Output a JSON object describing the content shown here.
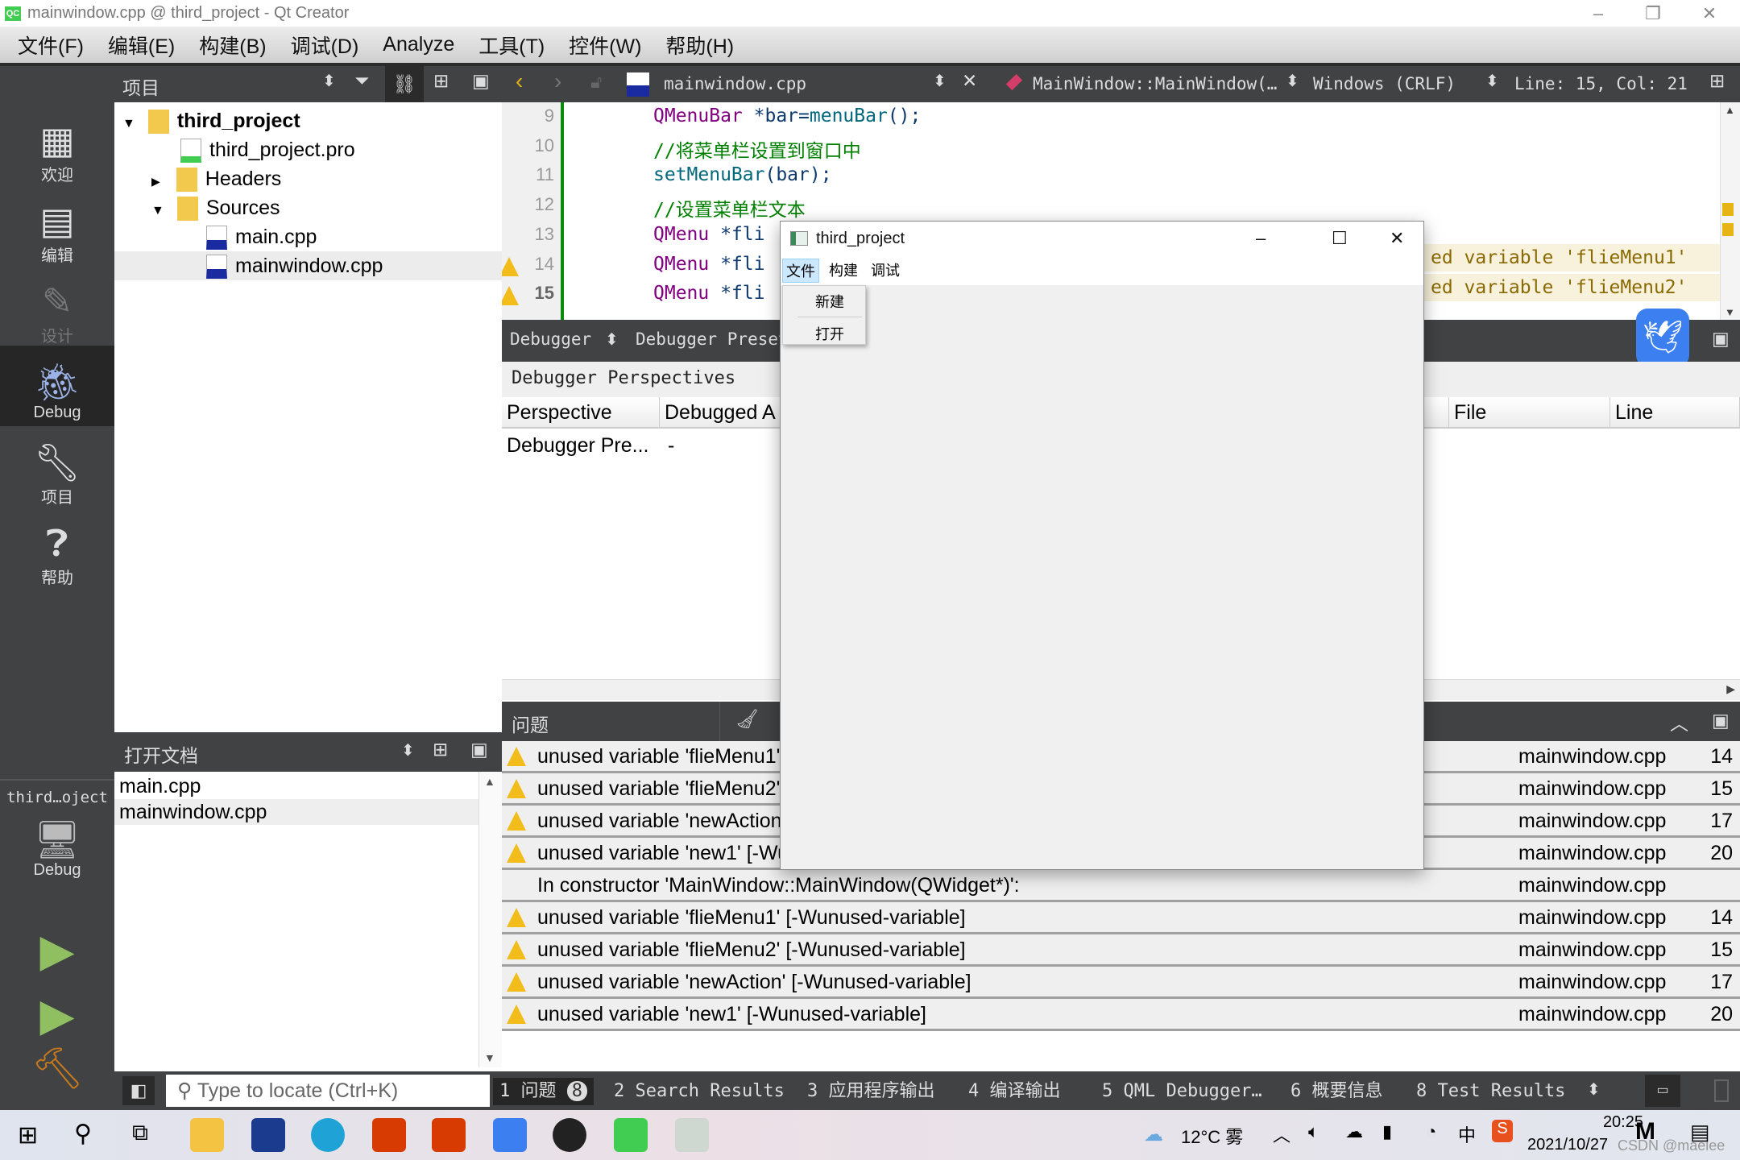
{
  "window": {
    "title": "mainwindow.cpp @ third_project - Qt Creator"
  },
  "menubar": [
    "文件(F)",
    "编辑(E)",
    "构建(B)",
    "调试(D)",
    "Analyze",
    "工具(T)",
    "控件(W)",
    "帮助(H)"
  ],
  "modes": [
    {
      "label": "欢迎",
      "icon": "grid-icon"
    },
    {
      "label": "编辑",
      "icon": "document-icon"
    },
    {
      "label": "设计",
      "icon": "pencil-icon"
    },
    {
      "label": "Debug",
      "icon": "bug-icon",
      "active": true
    },
    {
      "label": "项目",
      "icon": "wrench-icon"
    },
    {
      "label": "帮助",
      "icon": "help-icon"
    }
  ],
  "kit": {
    "project": "third…oject",
    "config": "Debug"
  },
  "project_panel": {
    "title": "项目",
    "tree": [
      {
        "label": "third_project",
        "level": 0,
        "expanded": true
      },
      {
        "label": "third_project.pro",
        "level": 1
      },
      {
        "label": "Headers",
        "level": 1,
        "expanded": false
      },
      {
        "label": "Sources",
        "level": 1,
        "expanded": true
      },
      {
        "label": "main.cpp",
        "level": 2
      },
      {
        "label": "mainwindow.cpp",
        "level": 2,
        "selected": true
      }
    ]
  },
  "open_docs": {
    "title": "打开文档",
    "items": [
      "main.cpp",
      "mainwindow.cpp"
    ]
  },
  "editor": {
    "file": "mainwindow.cpp",
    "symbol": "MainWindow::MainWindow(…",
    "encoding": "Windows (CRLF)",
    "position": "Line: 15, Col: 21",
    "lines": [
      {
        "n": "9",
        "parts": [
          [
            "kw",
            "QMenuBar "
          ],
          [
            "id",
            "*bar="
          ],
          [
            "fn",
            "menuBar"
          ],
          [
            "id",
            "();"
          ]
        ]
      },
      {
        "n": "10",
        "parts": [
          [
            "cm",
            "//将菜单栏设置到窗口中"
          ]
        ]
      },
      {
        "n": "11",
        "parts": [
          [
            "fn",
            "setMenuBar"
          ],
          [
            "id",
            "(bar);"
          ]
        ]
      },
      {
        "n": "12",
        "parts": [
          [
            "cm",
            "//设置菜单栏文本"
          ]
        ]
      },
      {
        "n": "13",
        "parts": [
          [
            "kw",
            "QMenu "
          ],
          [
            "id",
            "*fli"
          ]
        ]
      },
      {
        "n": "14",
        "warn": true,
        "parts": [
          [
            "kw",
            "QMenu "
          ],
          [
            "id",
            "*fli"
          ]
        ]
      },
      {
        "n": "15",
        "warn": true,
        "parts": [
          [
            "kw",
            "QMenu "
          ],
          [
            "id",
            "*fli"
          ]
        ]
      }
    ],
    "inline_warnings": [
      "ed variable 'flieMenu1'",
      "ed variable 'flieMenu2'"
    ]
  },
  "debugger": {
    "selector": "Debugger",
    "preset": "Debugger Preset",
    "perspectives_label": "Debugger Perspectives",
    "columns": [
      "Perspective",
      "Debugged A",
      "File",
      "Line"
    ],
    "row": [
      "Debugger Pre...",
      "-"
    ]
  },
  "problems": {
    "title": "问题",
    "rows": [
      {
        "warn": true,
        "text": "unused variable 'flieMenu1' [-Wunused-variable]",
        "file": "mainwindow.cpp",
        "line": "14"
      },
      {
        "warn": true,
        "text": "unused variable 'flieMenu2' [-Wunused-variable]",
        "file": "mainwindow.cpp",
        "line": "15"
      },
      {
        "warn": true,
        "text": "unused variable 'newAction' [-Wunused-variable]",
        "file": "mainwindow.cpp",
        "line": "17"
      },
      {
        "warn": true,
        "text": "unused variable 'new1' [-Wunused-variable]",
        "file": "mainwindow.cpp",
        "line": "20"
      },
      {
        "warn": false,
        "text": "In constructor 'MainWindow::MainWindow(QWidget*)':",
        "file": "mainwindow.cpp",
        "line": ""
      },
      {
        "warn": true,
        "text": "unused variable 'flieMenu1' [-Wunused-variable]",
        "file": "mainwindow.cpp",
        "line": "14"
      },
      {
        "warn": true,
        "text": "unused variable 'flieMenu2' [-Wunused-variable]",
        "file": "mainwindow.cpp",
        "line": "15"
      },
      {
        "warn": true,
        "text": "unused variable 'newAction' [-Wunused-variable]",
        "file": "mainwindow.cpp",
        "line": "17"
      },
      {
        "warn": true,
        "text": "unused variable 'new1' [-Wunused-variable]",
        "file": "mainwindow.cpp",
        "line": "20"
      }
    ]
  },
  "statusbar": {
    "locator_placeholder": "Type to locate (Ctrl+K)",
    "tabs": [
      "1 问题",
      "2 Search Results",
      "3 应用程序输出",
      "4 编译输出",
      "5 QML Debugger…",
      "6 概要信息",
      "8 Test Results"
    ],
    "problem_count": "8"
  },
  "popup": {
    "title": "third_project",
    "menus": [
      "文件",
      "构建",
      "调试"
    ],
    "dropdown": [
      "新建",
      "打开"
    ]
  },
  "taskbar": {
    "weather": "12°C 雾",
    "ime": "中",
    "time": "20:25",
    "date": "2021/10/27",
    "watermark": "CSDN @maelee"
  }
}
